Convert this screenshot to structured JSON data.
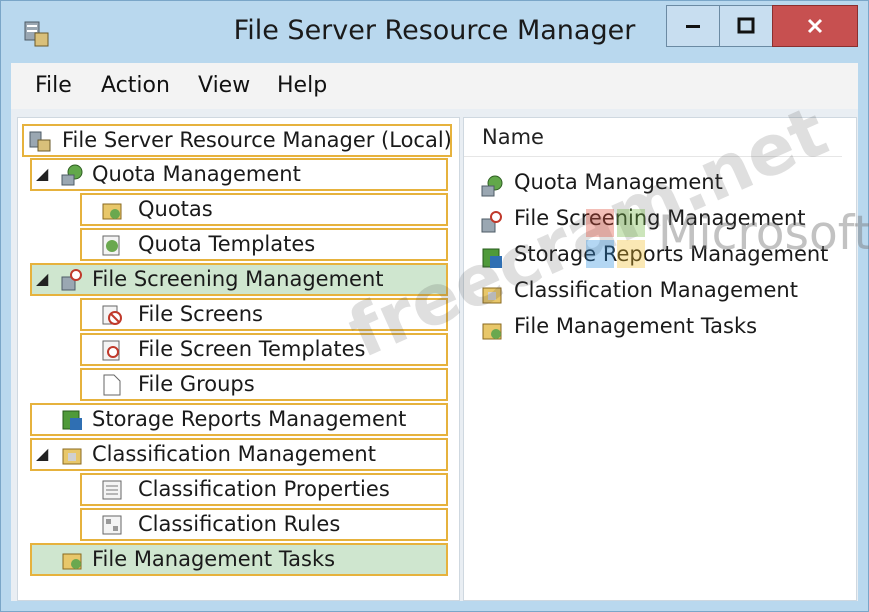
{
  "window": {
    "title": "File Server Resource Manager"
  },
  "menu": [
    "File",
    "Action",
    "View",
    "Help"
  ],
  "tree": {
    "root": "File Server Resource Manager (Local)",
    "items": [
      {
        "label": "Quota Management"
      },
      {
        "label": "Quotas"
      },
      {
        "label": "Quota Templates"
      },
      {
        "label": "File Screening Management"
      },
      {
        "label": "File Screens"
      },
      {
        "label": "File Screen Templates"
      },
      {
        "label": "File Groups"
      },
      {
        "label": "Storage Reports Management"
      },
      {
        "label": "Classification Management"
      },
      {
        "label": "Classification Properties"
      },
      {
        "label": "Classification Rules"
      },
      {
        "label": "File Management Tasks"
      }
    ]
  },
  "list": {
    "column": "Name",
    "items": [
      {
        "label": "Quota Management"
      },
      {
        "label": "File Screening Management"
      },
      {
        "label": "Storage Reports Management"
      },
      {
        "label": "Classification Management"
      },
      {
        "label": "File Management Tasks"
      }
    ]
  },
  "watermark": {
    "text": "freecram.net",
    "brand": "Microsoft"
  },
  "colors": {
    "accent_border": "#e6b23d",
    "selection": "#cfe6cf",
    "chrome": "#b9d8ee",
    "close": "#c75050"
  }
}
